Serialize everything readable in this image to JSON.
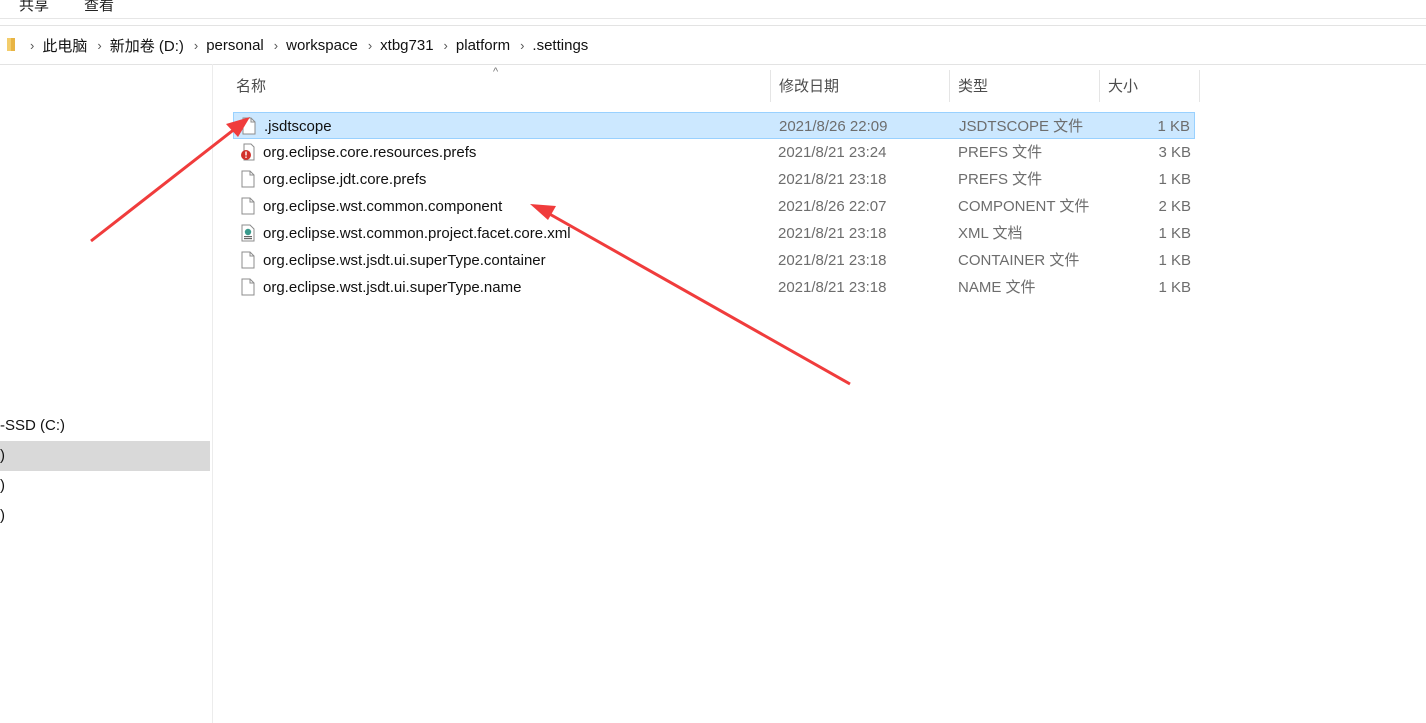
{
  "ribbon": {
    "tabs": [
      "共享",
      "查看"
    ]
  },
  "address": {
    "crumbs": [
      "此电脑",
      "新加卷 (D:)",
      "personal",
      "workspace",
      "xtbg731",
      "platform",
      ".settings"
    ]
  },
  "nav": {
    "items": [
      {
        "label": "-SSD (C:)",
        "selected": false
      },
      {
        "label": ")",
        "selected": true
      },
      {
        "label": ")",
        "selected": false
      },
      {
        "label": ")",
        "selected": false
      }
    ]
  },
  "columns": {
    "name": "名称",
    "date": "修改日期",
    "type": "类型",
    "size": "大小"
  },
  "files": [
    {
      "name": ".jsdtscope",
      "date": "2021/8/26 22:09",
      "type": "JSDTSCOPE 文件",
      "size": "1 KB",
      "icon": "blank-file-icon",
      "selected": true
    },
    {
      "name": "org.eclipse.core.resources.prefs",
      "date": "2021/8/21 23:24",
      "type": "PREFS 文件",
      "size": "3 KB",
      "icon": "prefs-warning-file-icon",
      "selected": false
    },
    {
      "name": "org.eclipse.jdt.core.prefs",
      "date": "2021/8/21 23:18",
      "type": "PREFS 文件",
      "size": "1 KB",
      "icon": "blank-file-icon",
      "selected": false
    },
    {
      "name": "org.eclipse.wst.common.component",
      "date": "2021/8/26 22:07",
      "type": "COMPONENT 文件",
      "size": "2 KB",
      "icon": "blank-file-icon",
      "selected": false
    },
    {
      "name": "org.eclipse.wst.common.project.facet.core.xml",
      "date": "2021/8/21 23:18",
      "type": "XML 文档",
      "size": "1 KB",
      "icon": "xml-file-icon",
      "selected": false
    },
    {
      "name": "org.eclipse.wst.jsdt.ui.superType.container",
      "date": "2021/8/21 23:18",
      "type": "CONTAINER 文件",
      "size": "1 KB",
      "icon": "blank-file-icon",
      "selected": false
    },
    {
      "name": "org.eclipse.wst.jsdt.ui.superType.name",
      "date": "2021/8/21 23:18",
      "type": "NAME 文件",
      "size": "1 KB",
      "icon": "blank-file-icon",
      "selected": false
    }
  ],
  "colors": {
    "selection": "#cce8ff",
    "selection_border": "#99d1ff",
    "annotation_arrow": "#f03c3c",
    "folder": "#e8b443"
  }
}
